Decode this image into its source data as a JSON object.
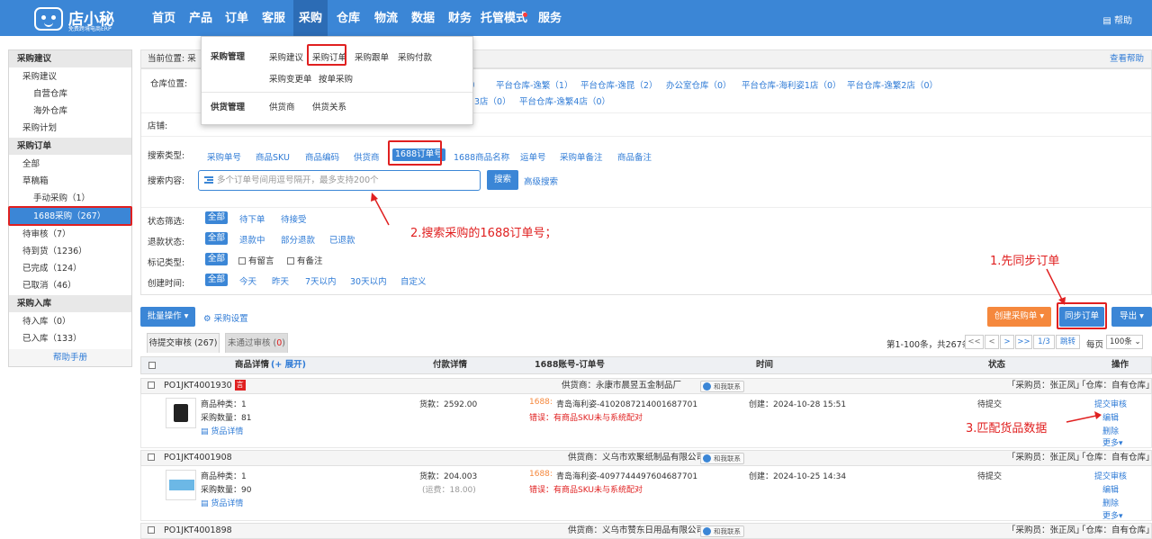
{
  "nav": {
    "logo_name": "店小秘",
    "logo_sub": "免费跨境电商ERP",
    "items": [
      "首页",
      "产品",
      "订单",
      "客服",
      "采购",
      "仓库",
      "物流",
      "数据",
      "财务",
      "托管模式",
      "服务"
    ],
    "help": "帮助"
  },
  "sidebar": {
    "purchase_suggest_header": "采购建议",
    "purchase_suggest": "采购建议",
    "own_warehouse": "自营仓库",
    "overseas_warehouse": "海外仓库",
    "purchase_plan": "采购计划",
    "purchase_order_header": "采购订单",
    "all": "全部",
    "draft_box": "草稿箱",
    "manual_purchase": "手动采购（1）",
    "purchase_1688": "1688采购（267）",
    "pending_review": "待审核（7）",
    "pending_arrival": "待到货（1236）",
    "completed": "已完成（124）",
    "cancelled": "已取消（46）",
    "inbound_header": "采购入库",
    "pending_inbound": "待入库（0）",
    "inbound_done": "已入库（133）",
    "help_manual": "帮助手册"
  },
  "dropdown": {
    "group1": "采购管理",
    "item1": "采购建议",
    "item2": "采购订单",
    "item3": "采购跟单",
    "item4": "采购付款",
    "item5": "采购变更单",
    "item6": "按单采购",
    "group2": "供货管理",
    "item7": "供货商",
    "item8": "供货关系"
  },
  "crumb": {
    "label": "当前位置:",
    "current": "采",
    "help": "查看帮助"
  },
  "filter": {
    "warehouse_label": "仓库位置:",
    "wh_row1": [
      "）",
      "平台仓库-逸繁（1）",
      "平台仓库-逸昆（2）",
      "办公室仓库（0）",
      "平台仓库-海利姿1店（0）",
      "平台仓库-逸繁2店（0）"
    ],
    "wh_row2": [
      "3店（0）",
      "平台仓库-逸繁4店（0）"
    ],
    "shop_label": "店铺:",
    "search_type_label": "搜索类型:",
    "search_types": [
      "采购单号",
      "商品SKU",
      "商品编码",
      "供货商",
      "1688订单号",
      "1688商品名称",
      "运单号",
      "采购单备注",
      "商品备注"
    ],
    "search_content_label": "搜索内容:",
    "search_placeholder": "多个订单号间用逗号隔开，最多支持200个",
    "search_button": "搜索",
    "advanced_search": "高级搜索",
    "status_label": "状态筛选:",
    "status_opts": [
      "全部",
      "待下单",
      "待接受"
    ],
    "refund_label": "退款状态:",
    "refund_opts": [
      "全部",
      "退款中",
      "部分退款",
      "已退款"
    ],
    "mark_label": "标记类型:",
    "mark_opts": [
      "全部",
      "有留言",
      "有备注"
    ],
    "time_label": "创建时间:",
    "time_opts": [
      "全部",
      "今天",
      "昨天",
      "7天以内",
      "30天以内",
      "自定义"
    ]
  },
  "annotations": {
    "a1": "1.先同步订单",
    "a2": "2.搜索采购的1688订单号；",
    "a3": "3.匹配货品数据"
  },
  "toolbar": {
    "batch": "批量操作",
    "settings": "采购设置",
    "create": "创建采购单",
    "sync": "同步订单",
    "export": "导出"
  },
  "tabs": {
    "tab1": "待提交审核 (267)",
    "tab2_text": "未通过审核 (",
    "tab2_count": "0",
    "tab2_close": ")"
  },
  "pagination": {
    "summary": "第1-100条，共267条",
    "first": "<<",
    "prev": "<",
    "next": ">",
    "last": ">>",
    "page": "1/3",
    "jump": "跳转",
    "per_page_label": "每页",
    "per_page": "100条"
  },
  "table": {
    "headers": [
      "商品详情",
      "(+ 展开)",
      "付款详情",
      "1688账号-订单号",
      "时间",
      "状态",
      "操作"
    ],
    "orders": [
      {
        "id": "PO1JKT4001930",
        "badge": "言",
        "supplier": "供货商：永康市晨昱五金制品厂",
        "contact": "和我联系",
        "buyer": "「采购员：张正凤」",
        "warehouse": "「仓库：自有仓库」",
        "kinds": "商品种类：1",
        "qty": "采购数量：81",
        "detail": "货品详情",
        "payment": "货款：2592.00",
        "freight": "",
        "order_prefix": "1688:",
        "order_no": "青岛海利姿-4102087214001687701",
        "error": "错误：有商品SKU未与系统配对",
        "time": "创建：2024-10-28 15:51",
        "status": "待提交",
        "ops": [
          "提交审核",
          "编辑",
          "删除",
          "更多"
        ]
      },
      {
        "id": "PO1JKT4001908",
        "badge": "",
        "supplier": "供货商：义乌市欢聚纸制品有限公司",
        "contact": "和我联系",
        "buyer": "「采购员：张正凤」",
        "warehouse": "「仓库：自有仓库」",
        "kinds": "商品种类：1",
        "qty": "采购数量：90",
        "detail": "货品详情",
        "payment": "货款：204.003",
        "freight": "(运费：18.00)",
        "order_prefix": "1688:",
        "order_no": "青岛海利姿-4097744497604687701",
        "error": "错误：有商品SKU未与系统配对",
        "time": "创建：2024-10-25 14:34",
        "status": "待提交",
        "ops": [
          "提交审核",
          "编辑",
          "删除",
          "更多"
        ]
      },
      {
        "id": "PO1JKT4001898",
        "supplier": "供货商：义乌市赞东日用品有限公司",
        "contact": "和我联系",
        "buyer": "「采购员：张正凤」",
        "warehouse": "「仓库：自有仓库」"
      }
    ]
  },
  "colors": {
    "primary": "#3b86d6",
    "annotation": "#e02020",
    "orange": "#f5883d"
  }
}
